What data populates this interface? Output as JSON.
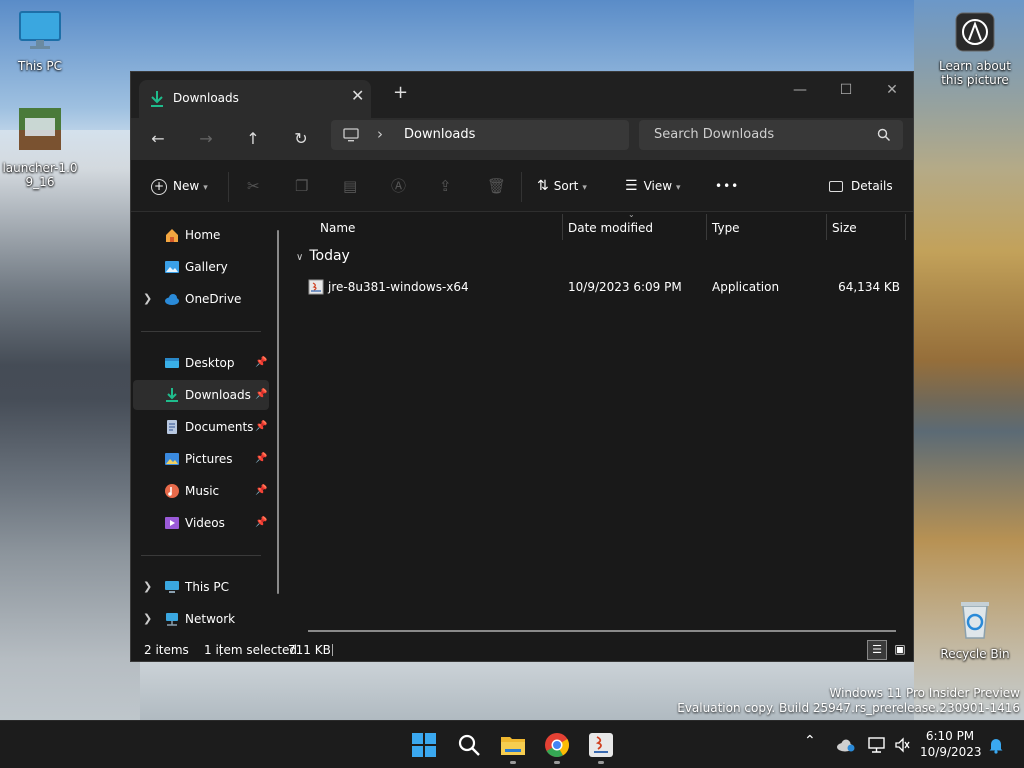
{
  "desktop": {
    "icons": [
      {
        "label": "This PC"
      },
      {
        "label": "launcher-1.09_16"
      },
      {
        "label": "Learn about this picture"
      },
      {
        "label": "Recycle Bin"
      }
    ],
    "watermark": {
      "line1": "Windows 11 Pro Insider Preview",
      "line2": "Evaluation copy. Build 25947.rs_prerelease.230901-1416"
    }
  },
  "window": {
    "tab_title": "Downloads",
    "tab_close": "✕",
    "new_tab": "+",
    "controls": {
      "minimize": "—",
      "maximize": "☐",
      "close": "✕"
    },
    "nav": {
      "back": "←",
      "forward": "→",
      "up": "↑",
      "refresh": "↻"
    },
    "address": {
      "separator": "›",
      "location": "Downloads"
    },
    "search": {
      "placeholder": "Search Downloads"
    },
    "toolbar": {
      "new": "New",
      "sort": "Sort",
      "view": "View",
      "more": "•••",
      "details": "Details"
    },
    "sidebar": {
      "items": [
        {
          "label": "Home"
        },
        {
          "label": "Gallery"
        },
        {
          "label": "OneDrive"
        },
        {
          "label": "Desktop"
        },
        {
          "label": "Downloads"
        },
        {
          "label": "Documents"
        },
        {
          "label": "Pictures"
        },
        {
          "label": "Music"
        },
        {
          "label": "Videos"
        },
        {
          "label": "This PC"
        },
        {
          "label": "Network"
        }
      ]
    },
    "columns": {
      "name": "Name",
      "date": "Date modified",
      "type": "Type",
      "size": "Size"
    },
    "group": {
      "label": "Today"
    },
    "files": [
      {
        "name": "jre-8u381-windows-x64",
        "date": "10/9/2023 6:09 PM",
        "type": "Application",
        "size": "64,134 KB"
      }
    ],
    "status": {
      "count": "2 items",
      "selection": "1 item selected",
      "selection_size": "711 KB"
    }
  },
  "taskbar": {
    "time": "6:10 PM",
    "date": "10/9/2023"
  },
  "colors": {
    "accent": "#1fbc8c",
    "folder": "#f0c040",
    "window_bg": "#191919"
  }
}
